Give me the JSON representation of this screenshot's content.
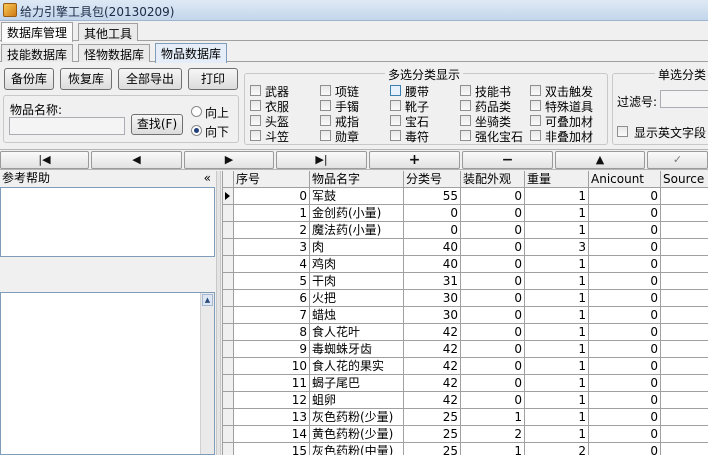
{
  "window": {
    "title": "给力引擎工具包(20130209)"
  },
  "top_tabs": [
    "数据库管理",
    "其他工具"
  ],
  "sub_tabs": [
    "技能数据库",
    "怪物数据库",
    "物品数据库"
  ],
  "buttons": {
    "backup": "备份库",
    "restore": "恢复库",
    "export_all": "全部导出",
    "print": "打印"
  },
  "item_search": {
    "label": "物品名称:",
    "value": "",
    "find_button": "查找(F)",
    "dir_up": "向上",
    "dir_down": "向下",
    "selected_direction": "向下"
  },
  "multi_category": {
    "title": "多选分类显示",
    "options": [
      {
        "label": "武器",
        "checked": false
      },
      {
        "label": "项链",
        "checked": false
      },
      {
        "label": "腰带",
        "checked": false,
        "highlight": true
      },
      {
        "label": "技能书",
        "checked": false
      },
      {
        "label": "双击触发",
        "checked": false
      },
      {
        "label": "衣服",
        "checked": false
      },
      {
        "label": "手镯",
        "checked": false
      },
      {
        "label": "靴子",
        "checked": false
      },
      {
        "label": "药品类",
        "checked": false
      },
      {
        "label": "特殊道具",
        "checked": false
      },
      {
        "label": "头盔",
        "checked": false
      },
      {
        "label": "戒指",
        "checked": false
      },
      {
        "label": "宝石",
        "checked": false
      },
      {
        "label": "坐骑类",
        "checked": false
      },
      {
        "label": "可叠加材",
        "checked": false
      },
      {
        "label": "斗笠",
        "checked": false
      },
      {
        "label": "勋章",
        "checked": false
      },
      {
        "label": "毒符",
        "checked": false
      },
      {
        "label": "强化宝石",
        "checked": false
      },
      {
        "label": "非叠加材",
        "checked": false
      }
    ]
  },
  "single_category": {
    "title": "单选分类",
    "filter_label": "过滤号:",
    "filter_value": "",
    "show_english_label": "显示英文字段",
    "show_english_checked": false
  },
  "navigator": {
    "first": "first",
    "prior": "prior",
    "next": "next",
    "last": "last",
    "insert": "insert",
    "delete": "delete",
    "edit": "edit",
    "post": "post"
  },
  "help_panel": {
    "title": "参考帮助",
    "collapse_glyph": "«"
  },
  "grid": {
    "columns": [
      "序号",
      "物品名字",
      "分类号",
      "装配外观",
      "重量",
      "Anicount",
      "Source"
    ],
    "rows": [
      [
        "0",
        "军鼓",
        "55",
        "0",
        "1",
        "0",
        ""
      ],
      [
        "1",
        "金创药(小量)",
        "0",
        "0",
        "1",
        "0",
        ""
      ],
      [
        "2",
        "魔法药(小量)",
        "0",
        "0",
        "1",
        "0",
        ""
      ],
      [
        "3",
        "肉",
        "40",
        "0",
        "3",
        "0",
        ""
      ],
      [
        "4",
        "鸡肉",
        "40",
        "0",
        "1",
        "0",
        ""
      ],
      [
        "5",
        "干肉",
        "31",
        "0",
        "1",
        "0",
        ""
      ],
      [
        "6",
        "火把",
        "30",
        "0",
        "1",
        "0",
        ""
      ],
      [
        "7",
        "蜡烛",
        "30",
        "0",
        "1",
        "0",
        ""
      ],
      [
        "8",
        "食人花叶",
        "42",
        "0",
        "1",
        "0",
        ""
      ],
      [
        "9",
        "毒蜘蛛牙齿",
        "42",
        "0",
        "1",
        "0",
        ""
      ],
      [
        "10",
        "食人花的果实",
        "42",
        "0",
        "1",
        "0",
        ""
      ],
      [
        "11",
        "蝎子尾巴",
        "42",
        "0",
        "1",
        "0",
        ""
      ],
      [
        "12",
        "蛆卵",
        "42",
        "0",
        "1",
        "0",
        ""
      ],
      [
        "13",
        "灰色药粉(少量)",
        "25",
        "1",
        "1",
        "0",
        ""
      ],
      [
        "14",
        "黄色药粉(少量)",
        "25",
        "2",
        "1",
        "0",
        ""
      ],
      [
        "15",
        "灰色药粉(中量)",
        "25",
        "1",
        "2",
        "0",
        ""
      ]
    ]
  }
}
